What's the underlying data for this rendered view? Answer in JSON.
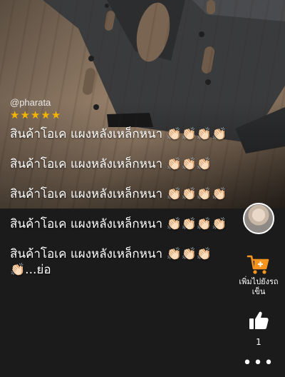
{
  "post": {
    "username": "@pharata",
    "rating_stars": 5,
    "stars": [
      "★",
      "★",
      "★",
      "★",
      "★"
    ],
    "lines": [
      "สินค้าโอเค แผงหลังเหล็กหนา 👏🏻👏🏻👏🏻👏🏻",
      "สินค้าโอเค แผงหลังเหล็กหนา 👏🏻👏🏻👏🏻",
      "สินค้าโอเค แผงหลังเหล็กหนา 👏🏻👏🏻👏🏻👏🏻",
      "สินค้าโอเค แผงหลังเหล็กหนา 👏🏻👏🏻👏🏻👏🏻"
    ],
    "last_line": "สินค้าโอเค แผงหลังเหล็กหนา 👏🏻👏🏻👏🏻👏🏻",
    "truncated_link": "...ย่อ"
  },
  "actions": {
    "add_to_cart_label": "เพิ่มไปยังรถเข็น",
    "like_count": "1",
    "more_label": "•••"
  },
  "colors": {
    "star": "#f5b400",
    "cart": "#f7941d",
    "background": "#1b1b1b"
  }
}
